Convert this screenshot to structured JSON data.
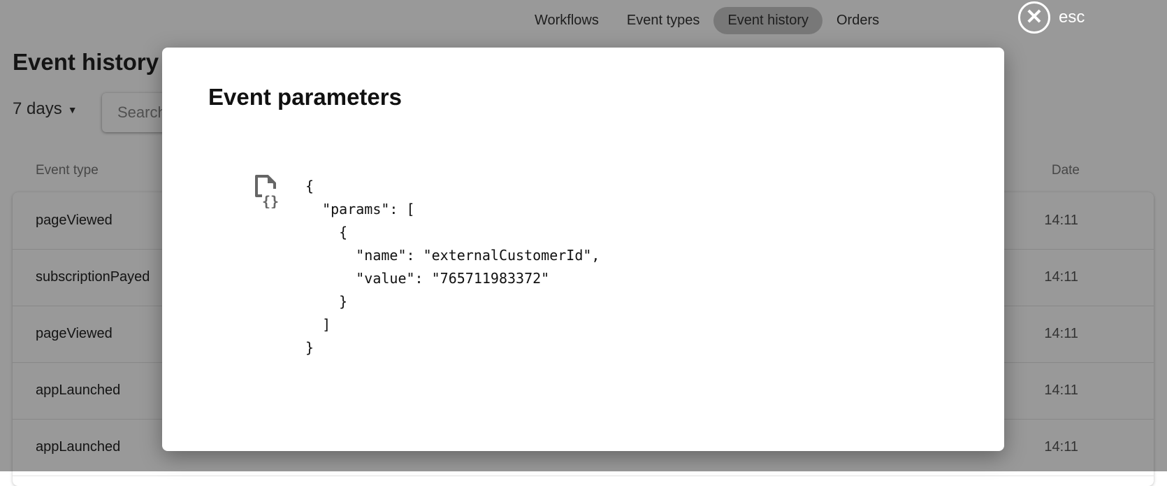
{
  "nav": {
    "items": [
      {
        "label": "Workflows",
        "active": false
      },
      {
        "label": "Event types",
        "active": false
      },
      {
        "label": "Event history",
        "active": true
      },
      {
        "label": "Orders",
        "active": false
      }
    ]
  },
  "page": {
    "title": "Event history",
    "range_select": "7 days",
    "search_placeholder": "Search"
  },
  "table": {
    "columns": [
      "Event type",
      "Date"
    ],
    "rows": [
      {
        "type": "pageViewed",
        "date": "14:11"
      },
      {
        "type": "subscriptionPayed",
        "date": "14:11"
      },
      {
        "type": "pageViewed",
        "date": "14:11"
      },
      {
        "type": "appLaunched",
        "date": "14:11"
      },
      {
        "type": "appLaunched",
        "date": "14:11"
      }
    ]
  },
  "close": {
    "label": "esc",
    "icon": "close-circle-icon"
  },
  "modal": {
    "title": "Event parameters",
    "icon": "json-file-icon",
    "json": "{\n  \"params\": [\n    {\n      \"name\": \"externalCustomerId\",\n      \"value\": \"765711983372\"\n    }\n  ]\n}"
  }
}
